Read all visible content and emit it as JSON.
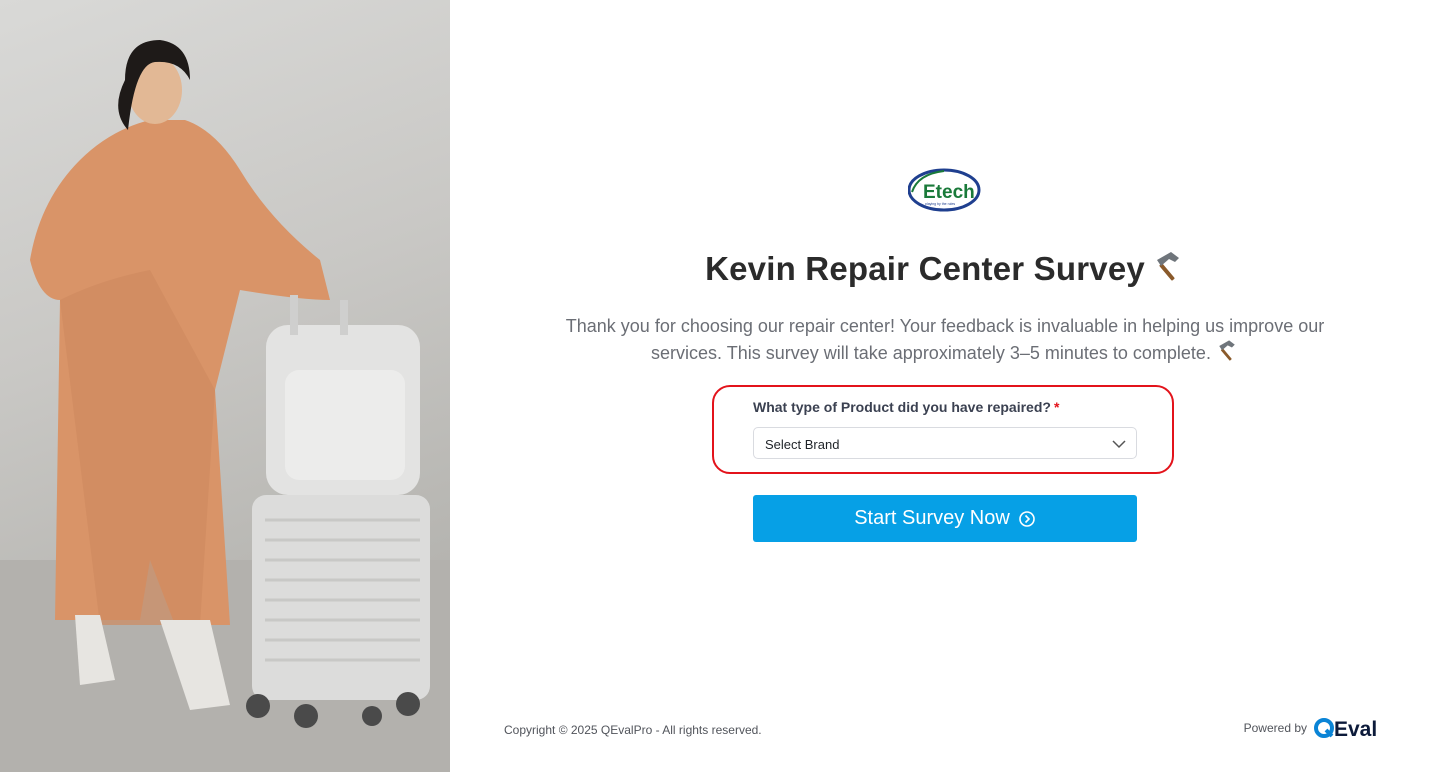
{
  "survey": {
    "logo_text": "Etech",
    "logo_tagline": "playing by the rules",
    "title": "Kevin Repair Center Survey",
    "description": "Thank you for choosing our repair center! Your feedback is invaluable in helping us improve our services. This survey will take approximately 3–5 minutes to complete.",
    "question_label": "What type of Product did you have repaired?",
    "required_mark": "*",
    "select_value": "Select Brand",
    "start_button_label": "Start Survey Now"
  },
  "footer": {
    "copyright": "Copyright © 2025 QEvalPro - All rights reserved.",
    "powered_by": "Powered by",
    "brand_name": "QEval"
  },
  "colors": {
    "accent_button": "#06a0e6",
    "highlight_border": "#e3131b",
    "logo_green": "#1a7a3a",
    "logo_blue": "#1f3f8f"
  }
}
